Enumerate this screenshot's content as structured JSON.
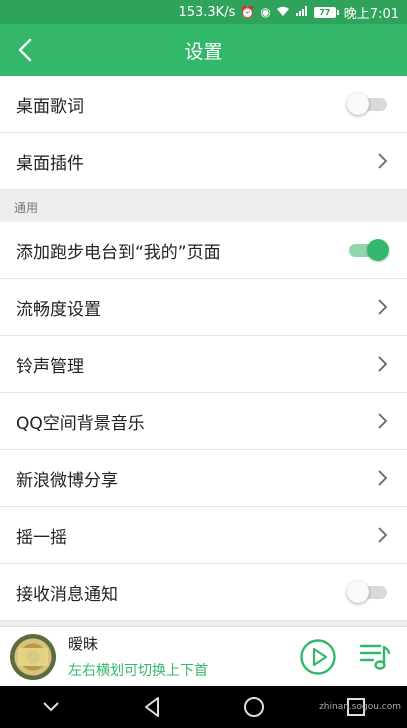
{
  "status_bar": {
    "speed": "153.3K/s",
    "battery": "77",
    "time": "晚上7:01"
  },
  "header": {
    "title": "设置",
    "back_icon": "back-arrow-icon"
  },
  "rows_top": [
    {
      "label": "桌面歌词",
      "control": "toggle",
      "on": false
    },
    {
      "label": "桌面插件",
      "control": "chevron"
    }
  ],
  "section_general": {
    "title": "通用"
  },
  "rows_general": [
    {
      "label": "添加跑步电台到“我的”页面",
      "control": "toggle",
      "on": true
    },
    {
      "label": "流畅度设置",
      "control": "chevron"
    },
    {
      "label": "铃声管理",
      "control": "chevron"
    },
    {
      "label": "QQ空间背景音乐",
      "control": "chevron"
    },
    {
      "label": "新浪微博分享",
      "control": "chevron"
    },
    {
      "label": "摇一摇",
      "control": "chevron"
    },
    {
      "label": "接收消息通知",
      "control": "toggle",
      "on": false
    }
  ],
  "player": {
    "song": "暧昧",
    "hint": "左右横划可切换上下首"
  },
  "watermark": "zhinan.sogou.com",
  "colors": {
    "accent": "#33b86b",
    "status_bar": "#2fa35c"
  }
}
